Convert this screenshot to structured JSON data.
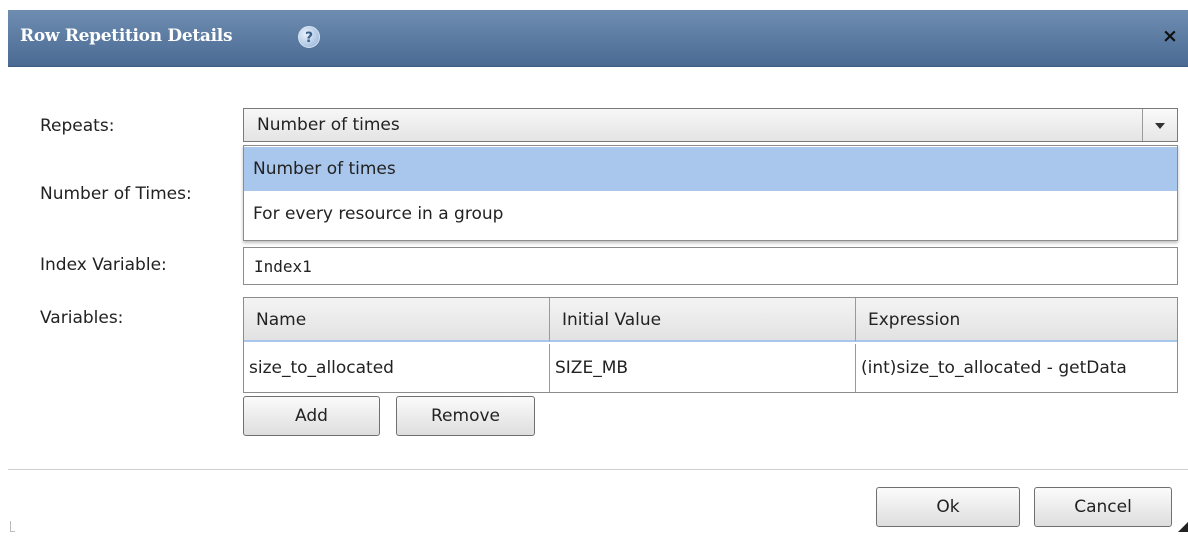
{
  "dialog": {
    "title": "Row Repetition Details",
    "help_icon": "?",
    "close_icon": "×"
  },
  "form": {
    "repeats_label": "Repeats:",
    "repeats_value": "Number of times",
    "repeats_options": [
      "Number of times",
      "For every resource in a group"
    ],
    "number_of_times_label": "Number of Times:",
    "index_variable_label": "Index Variable:",
    "index_variable_value": "Index1",
    "variables_label": "Variables:"
  },
  "variables_table": {
    "columns": [
      "Name",
      "Initial Value",
      "Expression"
    ],
    "rows": [
      [
        "size_to_allocated",
        "SIZE_MB",
        "(int)size_to_allocated - getData"
      ]
    ]
  },
  "buttons": {
    "add": "Add",
    "remove": "Remove",
    "ok": "Ok",
    "cancel": "Cancel"
  },
  "colors": {
    "titlebar": "#4a6a93",
    "selection": "#a9c6ec"
  },
  "icons": {
    "help": "help-circle-icon",
    "close": "close-icon",
    "dropdown": "chevron-down-icon",
    "resize": "resize-grip-icon"
  }
}
